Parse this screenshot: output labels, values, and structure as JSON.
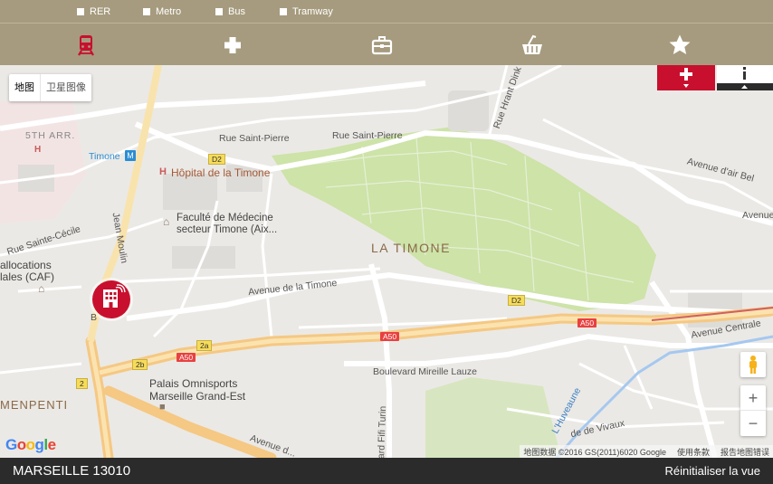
{
  "filters": [
    {
      "label": "RER"
    },
    {
      "label": "Metro"
    },
    {
      "label": "Bus"
    },
    {
      "label": "Tramway"
    }
  ],
  "categories": [
    {
      "icon": "train-icon",
      "active": true
    },
    {
      "icon": "health-cross-icon"
    },
    {
      "icon": "briefcase-icon"
    },
    {
      "icon": "shopping-basket-icon"
    },
    {
      "icon": "star-icon"
    }
  ],
  "colors": {
    "header_bg": "#a69b7e",
    "accent_red": "#c8102e",
    "park": "#cde3a8",
    "highway": "#f7d28b",
    "footer_bg": "#2b2b2b"
  },
  "map": {
    "type_map": "地图",
    "type_satellite": "卫星图像",
    "labels": {
      "arr": "5TH ARR.",
      "timone_metro": "Timone",
      "hopital": "Hôpital de la Timone",
      "faculte1": "Faculté de Médecine",
      "faculte2": "secteur Timone (Aix...",
      "la_timone": "LA TIMONE",
      "rue_st_pierre1": "Rue Saint-Pierre",
      "rue_st_pierre2": "Rue Saint-Pierre",
      "rue_st_cecile": "Rue Sainte-Cécile",
      "allocations1": "allocations",
      "allocations2": "lales (CAF)",
      "av_timone": "Avenue de la Timone",
      "bd_lauze": "Boulevard Mireille Lauze",
      "palais1": "Palais Omnisports",
      "palais2": "Marseille Grand-Est",
      "menpenti": "MENPENTI",
      "av_air_bel": "Avenue d'air Bel",
      "avenue": "Avenue",
      "av_centrale": "Avenue Centrale",
      "rue_hrant": "Rue Hrant Dink",
      "huveaune": "L'Huveaune",
      "de_vivaux": "de de Vivaux",
      "bd_fifi": "ard Fifi Turin",
      "av_bottom": "Avenue d...",
      "jean_moulin": "Jean Moulin",
      "bd_b": "B"
    },
    "shields": {
      "d2_a": "D2",
      "d2_b": "D2",
      "a50_a": "A50",
      "a50_b": "A50",
      "a50_c": "A50",
      "s2a": "2a",
      "s2b": "2b",
      "s2": "2"
    },
    "attribution": {
      "data": "地图数据 ©2016 GS(2011)6020 Google",
      "terms": "使用条款",
      "report": "报告地图错误"
    },
    "google": "Google",
    "zoom_in": "+",
    "zoom_out": "−"
  },
  "footer": {
    "location": "MARSEILLE 13010",
    "reset": "Réinitialiser la vue"
  }
}
